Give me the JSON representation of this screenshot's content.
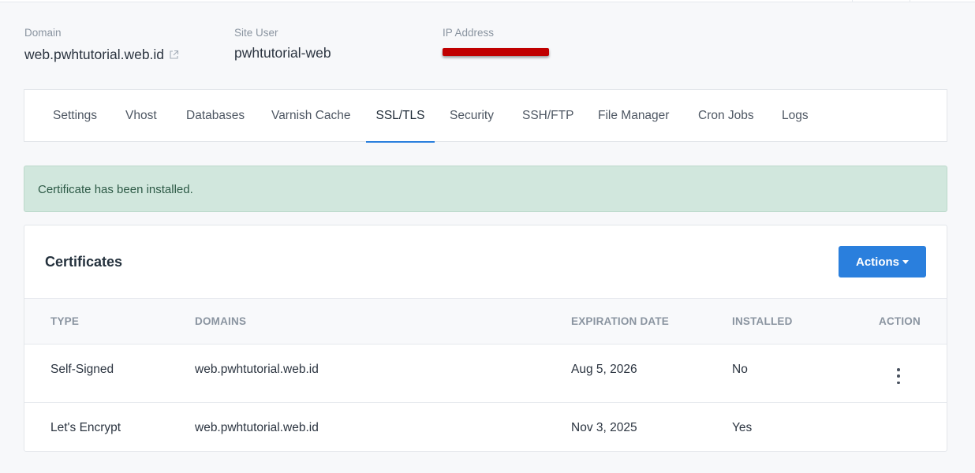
{
  "site": {
    "domain_label": "Domain",
    "domain_value": "web.pwhtutorial.web.id",
    "site_user_label": "Site User",
    "site_user_value": "pwhtutorial-web",
    "ip_label": "IP Address",
    "ip_value": "[redacted]"
  },
  "tabs": [
    {
      "label": "Settings",
      "active": false
    },
    {
      "label": "Vhost",
      "active": false
    },
    {
      "label": "Databases",
      "active": false
    },
    {
      "label": "Varnish Cache",
      "active": false
    },
    {
      "label": "SSL/TLS",
      "active": true
    },
    {
      "label": "Security",
      "active": false
    },
    {
      "label": "SSH/FTP",
      "active": false
    },
    {
      "label": "File Manager",
      "active": false
    },
    {
      "label": "Cron Jobs",
      "active": false
    },
    {
      "label": "Logs",
      "active": false
    }
  ],
  "alert": {
    "message": "Certificate has been installed."
  },
  "certificates": {
    "title": "Certificates",
    "actions_label": "Actions",
    "columns": [
      "TYPE",
      "DOMAINS",
      "EXPIRATION DATE",
      "INSTALLED",
      "ACTION"
    ],
    "rows": [
      {
        "type": "Self-Signed",
        "domains": "web.pwhtutorial.web.id",
        "expiration": "Aug 5, 2026",
        "installed": "No",
        "has_action_menu": true
      },
      {
        "type": "Let's Encrypt",
        "domains": "web.pwhtutorial.web.id",
        "expiration": "Nov 3, 2025",
        "installed": "Yes",
        "has_action_menu": false
      }
    ]
  },
  "colors": {
    "accent": "#2a7fdd",
    "success_bg": "#d1e7dd",
    "success_text": "#2d5a46",
    "redaction": "#c00000"
  }
}
